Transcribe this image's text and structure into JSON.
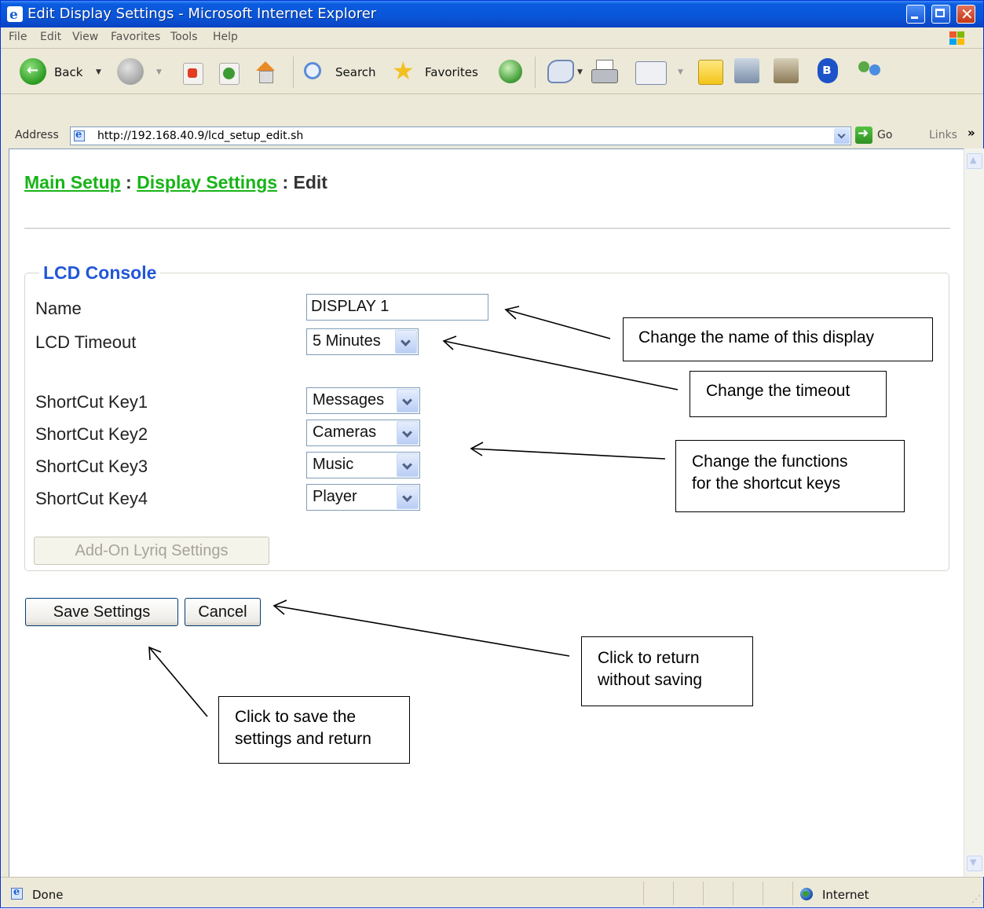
{
  "window": {
    "title": "Edit Display Settings - Microsoft Internet Explorer"
  },
  "menubar": {
    "items": [
      "File",
      "Edit",
      "View",
      "Favorites",
      "Tools",
      "Help"
    ]
  },
  "toolbar": {
    "back_label": "Back",
    "search_label": "Search",
    "favorites_label": "Favorites"
  },
  "addressbar": {
    "label": "Address",
    "url": "http://192.168.40.9/lcd_setup_edit.sh",
    "go_label": "Go",
    "links_label": "Links",
    "links_chevron": "»"
  },
  "page": {
    "breadcrumb": {
      "main_setup": "Main Setup",
      "sep1": " : ",
      "display_settings": "Display Settings",
      "sep2": " : ",
      "current": "Edit"
    },
    "fieldset_legend": "LCD Console",
    "name_label": "Name",
    "name_value": "DISPLAY 1",
    "lcd_timeout_label": "LCD Timeout",
    "lcd_timeout_value": "5 Minutes",
    "shortcuts": [
      {
        "label": "ShortCut Key1",
        "value": "Messages"
      },
      {
        "label": "ShortCut Key2",
        "value": "Cameras"
      },
      {
        "label": "ShortCut Key3",
        "value": "Music"
      },
      {
        "label": "ShortCut Key4",
        "value": "Player"
      }
    ],
    "addon_button": "Add-On Lyriq Settings",
    "save_button": "Save Settings",
    "cancel_button": "Cancel"
  },
  "annotations": {
    "name": "Change the name of this display",
    "timeout": "Change the timeout",
    "shortcuts_line1": "Change the functions",
    "shortcuts_line2": "for the shortcut keys",
    "cancel_line1": "Click to return",
    "cancel_line2": "without saving",
    "save_line1": "Click to save the",
    "save_line2": "settings and return"
  },
  "statusbar": {
    "status": "Done",
    "zone": "Internet"
  }
}
